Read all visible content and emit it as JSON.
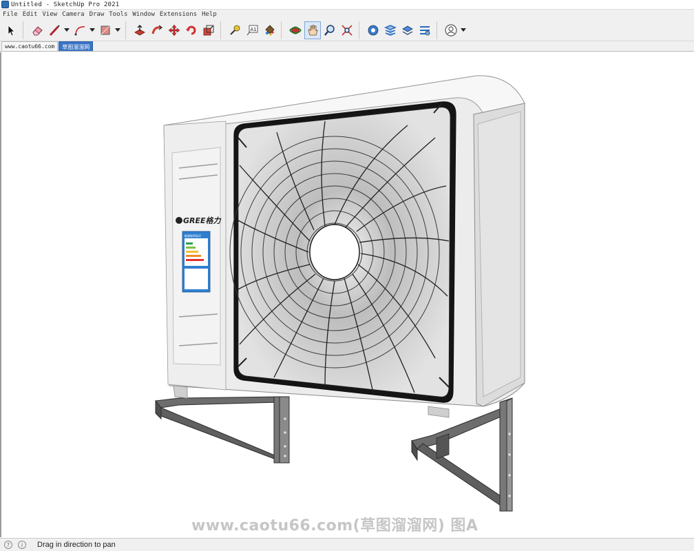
{
  "window": {
    "title": "Untitled - SketchUp Pro 2021"
  },
  "menu": [
    "File",
    "Edit",
    "View",
    "Camera",
    "Draw",
    "Tools",
    "Window",
    "Extensions",
    "Help"
  ],
  "toolbar": {
    "icons": [
      "select-icon",
      "eraser-icon",
      "line-icon",
      "arc-icon",
      "rectangle-icon",
      "push-pull-icon",
      "follow-me-icon",
      "move-icon",
      "rotate-icon",
      "scale-icon",
      "tape-measure-icon",
      "text-icon",
      "paint-bucket-icon",
      "orbit-icon",
      "pan-icon",
      "zoom-icon",
      "zoom-extents-icon",
      "warehouse-icon",
      "extension-warehouse-icon",
      "layout-icon",
      "extension-manager-icon",
      "account-icon"
    ]
  },
  "tabs": [
    "www.caotu66.com",
    "草图溜溜网"
  ],
  "model": {
    "brand": "GREE格力",
    "label_header": "能源效率标识"
  },
  "watermark": "www.caotu66.com(草图溜溜网) 图A",
  "status": {
    "message": "Drag in direction to pan"
  },
  "colors": {
    "accent": "#3a73c4",
    "toolbar_bg": "#f0f0f0"
  }
}
